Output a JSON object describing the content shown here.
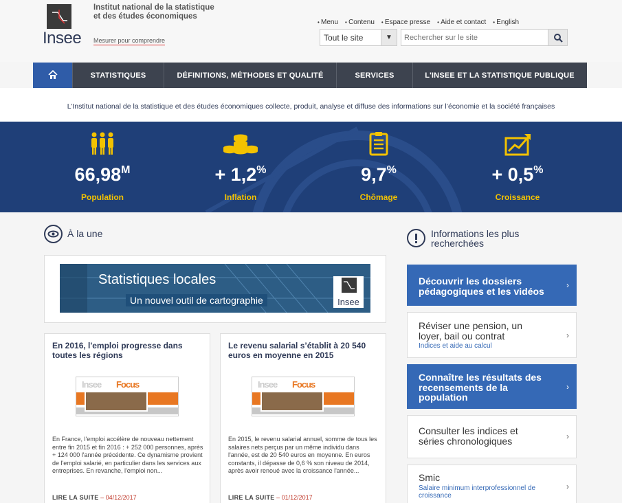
{
  "header": {
    "institute_name": "Institut national de la statistique et des études économiques",
    "logo_word": "Insee",
    "tagline": "Mesurer pour comprendre",
    "util_links": [
      "Menu",
      "Contenu",
      "Espace presse",
      "Aide et contact",
      "English"
    ],
    "scope_value": "Tout le site",
    "search_placeholder": "Rechercher sur le site"
  },
  "nav": {
    "items": [
      "STATISTIQUES",
      "DÉFINITIONS, MÉTHODES ET QUALITÉ",
      "SERVICES",
      "L'INSEE ET LA STATISTIQUE PUBLIQUE"
    ]
  },
  "intro": "L’Institut national de la statistique et des études économiques collecte, produit, analyse et diffuse des informations sur l’économie et la société françaises",
  "stats": [
    {
      "value": "66,98",
      "unit": "M",
      "label": "Population",
      "icon": "people-icon"
    },
    {
      "value": "+ 1,2",
      "unit": "%",
      "label": "Inflation",
      "icon": "coins-icon"
    },
    {
      "value": "9,7",
      "unit": "%",
      "label": "Chômage",
      "icon": "clipboard-icon"
    },
    {
      "value": "+ 0,5",
      "unit": "%",
      "label": "Croissance",
      "icon": "growth-chart-icon"
    }
  ],
  "une": {
    "title": "À la une",
    "banner_title": "Statistiques locales",
    "banner_subtitle": "Un nouvel outil de cartographie",
    "banner_logo": "Insee"
  },
  "news": [
    {
      "title": "En 2016, l'emploi progresse dans toutes les régions",
      "image_word1": "Insee",
      "image_word2": "Focus",
      "body": "En France, l'emploi accélère de nouveau nettement entre fin 2015 et fin 2016 : + 252 000 personnes, après + 124 000 l'année précédente. Ce dynamisme provient de l'emploi salarié, en particulier dans les services aux entreprises. En revanche, l'emploi non...",
      "more": "LIRE LA SUITE",
      "date": "– 04/12/2017"
    },
    {
      "title": "Le revenu salarial s’établit à 20 540 euros en moyenne en 2015",
      "image_word1": "Insee",
      "image_word2": "Focus",
      "body": "En 2015, le revenu salarial annuel, somme de tous les salaires nets perçus par un même individu dans l'année, est de 20 540 euros en moyenne. En euros constants, il dépasse de 0,6 % son niveau de 2014, après avoir renoué avec la croissance l'année...",
      "more": "LIRE LA SUITE",
      "date": "– 01/12/2017"
    }
  ],
  "info": {
    "title": "Informations les plus recherchées",
    "links": [
      {
        "main": "Découvrir les dossiers pédagogiques et les vidéos",
        "sub": "",
        "style": "blue"
      },
      {
        "main": "Réviser une pension, un loyer, bail ou contrat",
        "sub": "Indices et aide au calcul",
        "style": "white"
      },
      {
        "main": "Connaître les résultats des recensements de la population",
        "sub": "",
        "style": "blue"
      },
      {
        "main": "Consulter les indices et séries chronologiques",
        "sub": "",
        "style": "white"
      },
      {
        "main": "Smic",
        "sub": "Salaire minimum interprofessionnel de croissance",
        "style": "white"
      }
    ]
  },
  "colors": {
    "brand_blue": "#1f3f78",
    "accent_yellow": "#f3c200",
    "nav_dark": "#3d434f",
    "link_blue": "#3569b6"
  }
}
